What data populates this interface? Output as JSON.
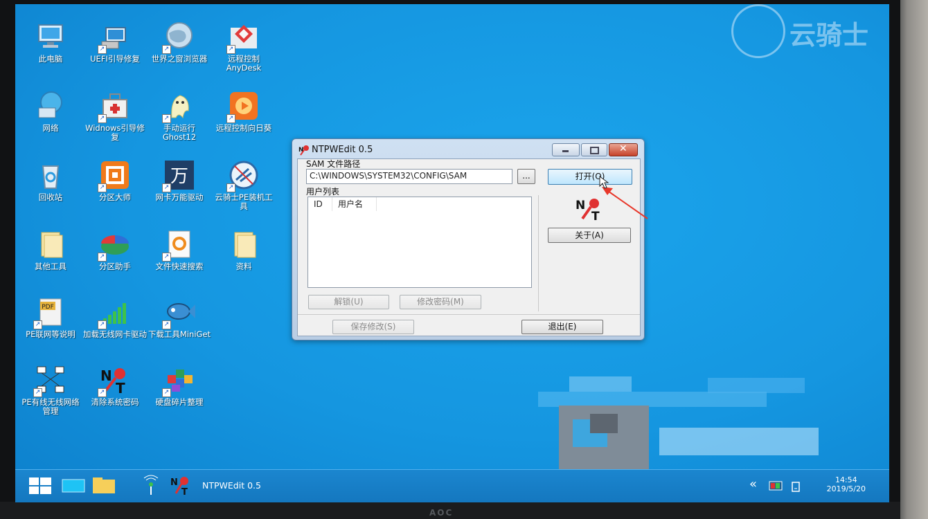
{
  "desktop_icons": [
    {
      "label": "此电脑",
      "icon": "computer-icon"
    },
    {
      "label": "UEFI引导修复",
      "icon": "uefi-repair-icon"
    },
    {
      "label": "世界之窗浏览器",
      "icon": "browser-globe-icon"
    },
    {
      "label": "远程控制AnyDesk",
      "icon": "anydesk-icon"
    },
    {
      "label": "网络",
      "icon": "network-globe-icon"
    },
    {
      "label": "Widnows引导修复",
      "icon": "toolbox-icon"
    },
    {
      "label": "手动运行Ghost12",
      "icon": "ghost-icon"
    },
    {
      "label": "远程控制向日葵",
      "icon": "sunflower-icon"
    },
    {
      "label": "回收站",
      "icon": "recycle-bin-icon"
    },
    {
      "label": "分区大师",
      "icon": "partition-master-icon"
    },
    {
      "label": "网卡万能驱动",
      "icon": "wan-driver-icon"
    },
    {
      "label": "云骑士PE装机工具",
      "icon": "yunqishi-icon"
    },
    {
      "label": "其他工具",
      "icon": "folder-icon"
    },
    {
      "label": "分区助手",
      "icon": "partition-assistant-icon"
    },
    {
      "label": "文件快速搜索",
      "icon": "file-search-icon"
    },
    {
      "label": "资料",
      "icon": "folder-icon"
    },
    {
      "label": "PE联网等说明",
      "icon": "pdf-icon"
    },
    {
      "label": "加载无线网卡驱动",
      "icon": "wifi-bars-icon"
    },
    {
      "label": "下载工具MiniGet",
      "icon": "fish-icon"
    },
    {
      "label": "PE有线无线网络管理",
      "icon": "network-manager-icon"
    },
    {
      "label": "清除系统密码",
      "icon": "ntpw-key-icon"
    },
    {
      "label": "硬盘碎片整理",
      "icon": "defrag-cubes-icon"
    }
  ],
  "watermark": {
    "text": "云骑士"
  },
  "dialog": {
    "title": "NTPWEdit 0.5",
    "sam_label": "SAM 文件路径",
    "sam_path": "C:\\WINDOWS\\SYSTEM32\\CONFIG\\SAM",
    "browse_label": "...",
    "open_label": "打开(O)",
    "userlist_label": "用户列表",
    "columns": [
      "ID",
      "用户名"
    ],
    "about_label": "关于(A)",
    "unlock_label": "解锁(U)",
    "change_pw_label": "修改密码(M)",
    "save_label": "保存修改(S)",
    "exit_label": "退出(E)"
  },
  "taskbar": {
    "app_label": "NTPWEdit 0.5",
    "time": "14:54",
    "date": "2019/5/20",
    "tray_chevron": "«"
  },
  "monitor_brand": "AOC",
  "colors": {
    "desktop": "#1596e0",
    "taskbar": "#1477bf",
    "arrow": "#e8372a"
  }
}
